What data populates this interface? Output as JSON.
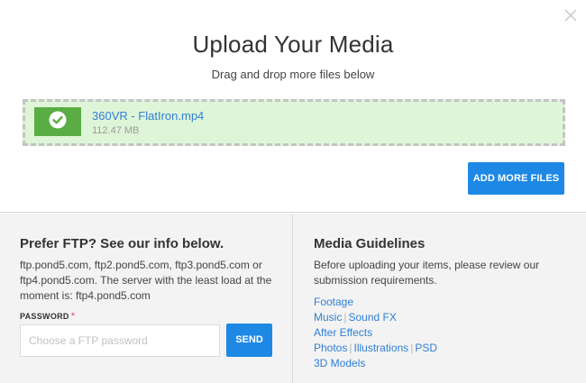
{
  "upload": {
    "title": "Upload Your Media",
    "subtitle": "Drag and drop more files below",
    "file": {
      "name": "360VR - FlatIron.mp4",
      "size": "112.47 MB"
    },
    "add_button": "ADD MORE FILES"
  },
  "ftp": {
    "heading": "Prefer FTP? See our info below.",
    "info": "ftp.pond5.com, ftp2.pond5.com, ftp3.pond5.com or ftp4.pond5.com. The server with the least load at the moment is: ftp4.pond5.com",
    "password_label": "PASSWORD",
    "required_mark": "*",
    "password_placeholder": "Choose a FTP password",
    "password_value": "",
    "send_button": "SEND"
  },
  "guidelines": {
    "heading": "Media Guidelines",
    "info": "Before uploading your items, please review our submission requirements.",
    "links": {
      "footage": "Footage",
      "music": "Music",
      "sound_fx": "Sound FX",
      "after_effects": "After Effects",
      "photos": "Photos",
      "illustrations": "Illustrations",
      "psd": "PSD",
      "models_3d": "3D Models"
    },
    "separator": "|"
  },
  "colors": {
    "accent": "#1e88e5",
    "link": "#2f7fd6",
    "success": "#5aad43",
    "dropzone_bg": "#dff5d8",
    "required": "#e0435a"
  },
  "icons": {
    "close": "close-icon",
    "check": "check-circle-icon"
  }
}
